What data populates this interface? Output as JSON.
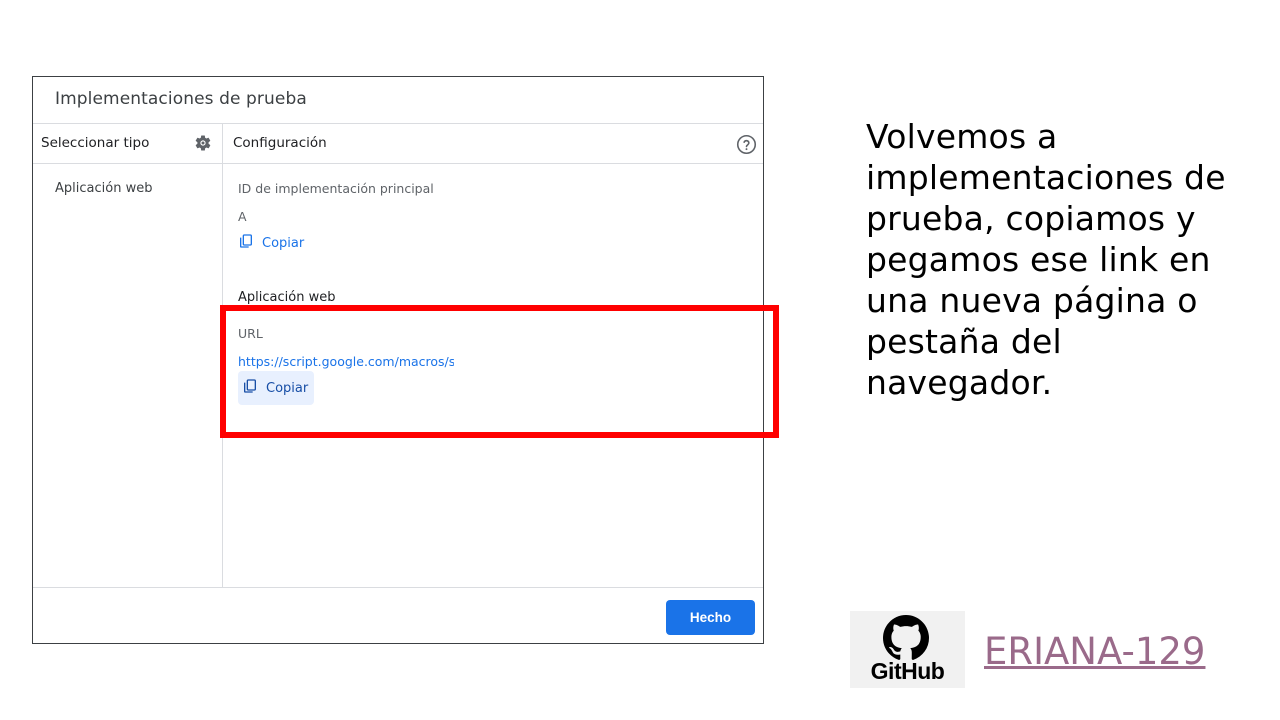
{
  "dialog": {
    "title": "Implementaciones de prueba",
    "left_column_header": "Seleccionar tipo",
    "right_column_header": "Configuración",
    "side_items": [
      "Aplicación web"
    ],
    "deployment_id_label": "ID de implementación principal",
    "deployment_id_value": "A",
    "copy_label_1": "Copiar",
    "web_app_section": "Aplicación web",
    "url_label": "URL",
    "url_value": "https://script.google.com/macros/s/A",
    "copy_label_2": "Copiar",
    "done_button": "Hecho"
  },
  "caption": "Volvemos a implementaciones de prueba, copiamos y pegamos ese link en una nueva página o pestaña del navegador.",
  "github": {
    "logo_text": "GitHub",
    "username": "ERIANA-129"
  },
  "colors": {
    "accent": "#1a73e8",
    "highlight_border": "#ff0000",
    "username_link": "#9a6a8a"
  },
  "icons": {
    "settings": "gear-icon",
    "help": "help-circle-icon",
    "copy": "copy-icon",
    "github": "github-octocat-icon"
  }
}
